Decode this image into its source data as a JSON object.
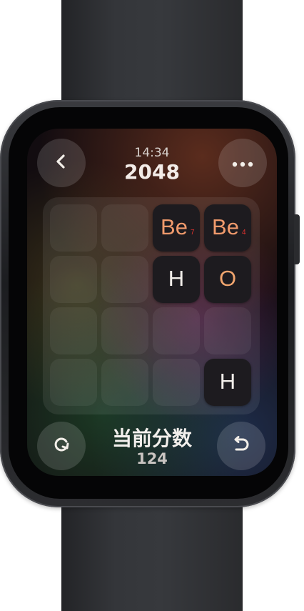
{
  "colors": {
    "tile_bg": "#1d1b1f",
    "be_symbol": "#f09a6c",
    "o_symbol": "#f0a56e",
    "h_symbol": "#f2eeea",
    "atomic_number": "#e0322e"
  },
  "icons": {
    "back": "chevron-left-icon",
    "more": "more-horizontal-icon",
    "restart": "restart-icon",
    "undo": "undo-icon"
  },
  "header": {
    "time": "14:34",
    "title": "2048"
  },
  "board": {
    "rows": 4,
    "cols": 4,
    "tiles": [
      {
        "row": 0,
        "col": 2,
        "symbol": "Be",
        "number": "7"
      },
      {
        "row": 0,
        "col": 3,
        "symbol": "Be",
        "number": "4"
      },
      {
        "row": 1,
        "col": 2,
        "symbol": "H",
        "number": ""
      },
      {
        "row": 1,
        "col": 3,
        "symbol": "O",
        "number": ""
      },
      {
        "row": 3,
        "col": 3,
        "symbol": "H",
        "number": ""
      }
    ]
  },
  "footer": {
    "score_label": "当前分数",
    "score_value": "124"
  }
}
